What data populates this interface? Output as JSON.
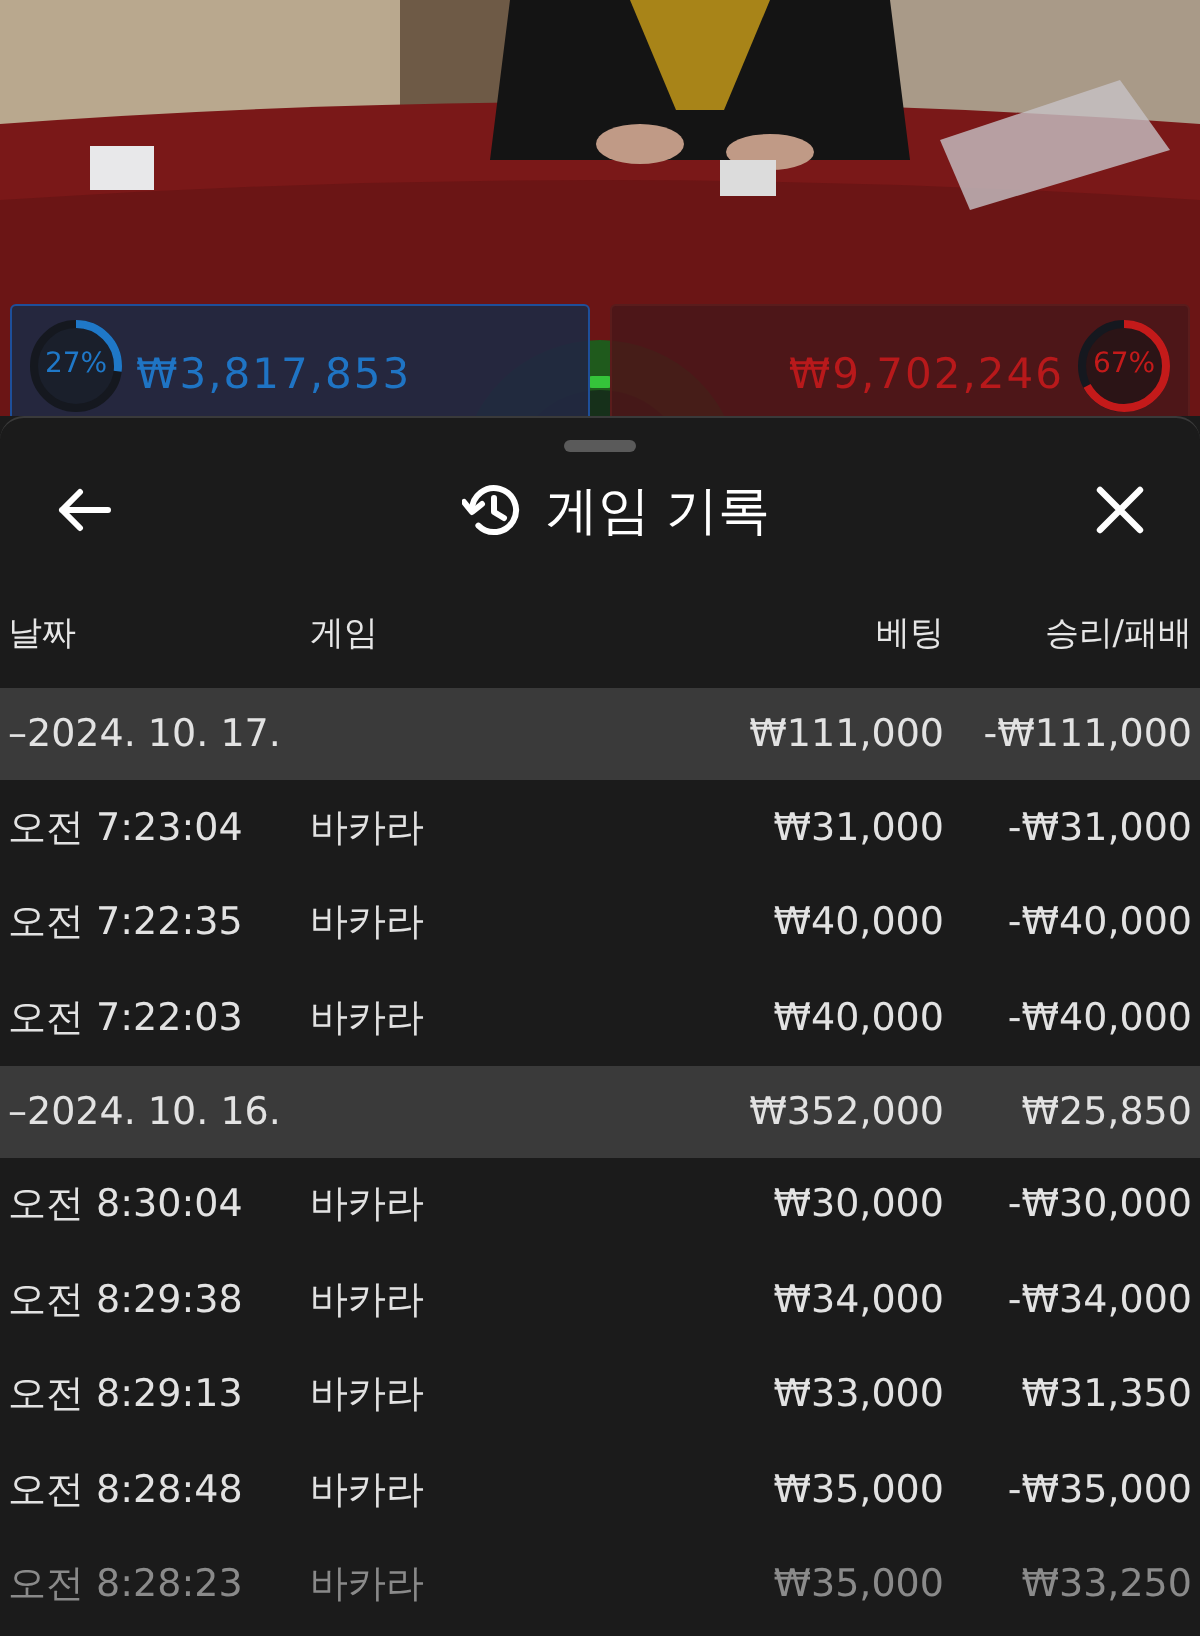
{
  "overlay": {
    "player": {
      "amount": "₩3,817,853",
      "percent": "27%",
      "level": 0.27
    },
    "banker": {
      "amount": "₩9,702,246",
      "percent": "67%",
      "level": 0.67
    }
  },
  "sheet": {
    "title": "게임 기록",
    "columns": [
      "날짜",
      "게임",
      "베팅",
      "승리/패배"
    ],
    "groups": [
      {
        "date": "–2024. 10. 17.",
        "bet": "₩111,000",
        "result": "-₩111,000",
        "rows": [
          {
            "time": "오전 7:23:04",
            "game": "바카라",
            "bet": "₩31,000",
            "result": "-₩31,000",
            "dimmed": false
          },
          {
            "time": "오전 7:22:35",
            "game": "바카라",
            "bet": "₩40,000",
            "result": "-₩40,000",
            "dimmed": false
          },
          {
            "time": "오전 7:22:03",
            "game": "바카라",
            "bet": "₩40,000",
            "result": "-₩40,000",
            "dimmed": false
          }
        ]
      },
      {
        "date": "–2024. 10. 16.",
        "bet": "₩352,000",
        "result": "₩25,850",
        "rows": [
          {
            "time": "오전 8:30:04",
            "game": "바카라",
            "bet": "₩30,000",
            "result": "-₩30,000",
            "dimmed": false
          },
          {
            "time": "오전 8:29:38",
            "game": "바카라",
            "bet": "₩34,000",
            "result": "-₩34,000",
            "dimmed": false
          },
          {
            "time": "오전 8:29:13",
            "game": "바카라",
            "bet": "₩33,000",
            "result": "₩31,350",
            "dimmed": false
          },
          {
            "time": "오전 8:28:48",
            "game": "바카라",
            "bet": "₩35,000",
            "result": "-₩35,000",
            "dimmed": false
          },
          {
            "time": "오전 8:28:23",
            "game": "바카라",
            "bet": "₩35,000",
            "result": "₩33,250",
            "dimmed": true
          }
        ]
      }
    ]
  }
}
